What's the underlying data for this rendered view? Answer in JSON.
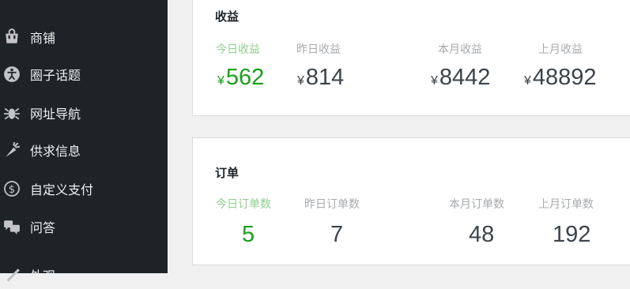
{
  "sidebar": {
    "items": [
      {
        "label": "商铺",
        "icon": "store-icon"
      },
      {
        "label": "圈子话题",
        "icon": "accessibility-icon"
      },
      {
        "label": "网址导航",
        "icon": "bug-icon"
      },
      {
        "label": "供求信息",
        "icon": "carrot-icon"
      },
      {
        "label": "自定义支付",
        "icon": "dollar-circle-icon"
      },
      {
        "label": "问答",
        "icon": "chat-bubbles-icon"
      },
      {
        "label": "外观",
        "icon": "paint-brush-icon"
      }
    ]
  },
  "income": {
    "title": "收益",
    "currency": "¥",
    "today_label": "今日收益",
    "today_value": "562",
    "yesterday_label": "昨日收益",
    "yesterday_value": "814",
    "month_label": "本月收益",
    "month_value": "8442",
    "last_month_label": "上月收益",
    "last_month_value": "48892"
  },
  "orders": {
    "title": "订单",
    "today_label": "今日订单数",
    "today_value": "5",
    "yesterday_label": "昨日订单数",
    "yesterday_value": "7",
    "month_label": "本月订单数",
    "month_value": "48",
    "last_month_label": "上月订单数",
    "last_month_value": "192"
  },
  "colors": {
    "sidebar_bg": "#1d2327",
    "active_green": "#1aa01a",
    "active_label_green": "#8fcf8f"
  }
}
